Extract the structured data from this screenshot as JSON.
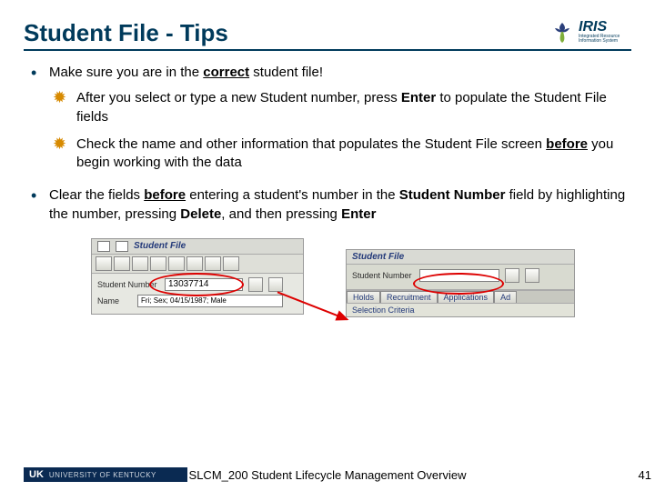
{
  "title": "Student File - Tips",
  "logo": {
    "name": "IRIS",
    "sub": "Integrated Resource Information System"
  },
  "bullets": [
    {
      "text_parts": [
        "Make sure you are in the ",
        "correct",
        " student file!"
      ],
      "subs": [
        {
          "parts": [
            "After you select or type a new Student number, press ",
            "Enter",
            " to populate the Student File fields"
          ]
        },
        {
          "parts": [
            "Check the name and other information that populates the Student File screen ",
            "before",
            " you begin working with the data"
          ]
        }
      ]
    },
    {
      "text_parts": [
        "Clear the fields ",
        "before",
        " entering a student's number in the ",
        "Student Number",
        " field by highlighting the number, pressing ",
        "Delete",
        ", and then pressing ",
        "Enter"
      ]
    }
  ],
  "panel1": {
    "title": "Student File",
    "fields": {
      "student_number_label": "Student Number",
      "student_number_value": "13037714",
      "name_label": "Name",
      "name_value": "",
      "detail_value": "Fri; Sex; 04/15/1987; Male"
    }
  },
  "panel2": {
    "title": "Student File",
    "fields": {
      "student_number_label": "Student Number",
      "student_number_value": ""
    },
    "tabs": [
      "Holds",
      "Recruitment",
      "Applications",
      "Ad"
    ],
    "selection_label": "Selection Criteria"
  },
  "footer": {
    "uk_short": "UK",
    "uk_name": "UNIVERSITY OF KENTUCKY",
    "center": "SLCM_200 Student Lifecycle Management Overview",
    "page": "41"
  }
}
